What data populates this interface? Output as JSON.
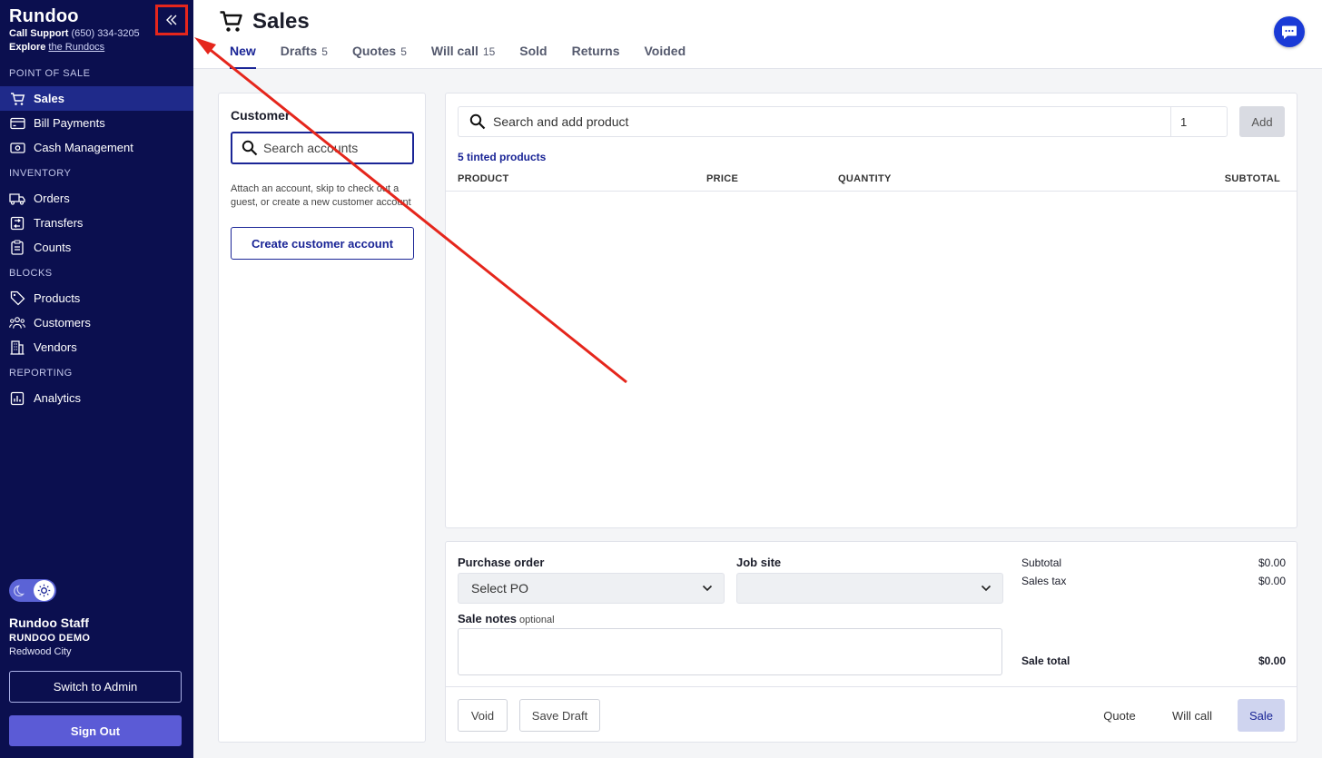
{
  "app": {
    "name": "Rundoo",
    "support_label": "Call Support",
    "support_phone": "(650) 334-3205",
    "explore_label": "Explore",
    "explore_link": "the Rundocs"
  },
  "sidebar": {
    "sections": [
      {
        "heading": "POINT OF SALE",
        "items": [
          {
            "label": "Sales",
            "icon": "cart-icon",
            "active": true
          },
          {
            "label": "Bill Payments",
            "icon": "credit-card-icon"
          },
          {
            "label": "Cash Management",
            "icon": "cash-icon"
          }
        ]
      },
      {
        "heading": "INVENTORY",
        "items": [
          {
            "label": "Orders",
            "icon": "truck-icon"
          },
          {
            "label": "Transfers",
            "icon": "transfer-icon"
          },
          {
            "label": "Counts",
            "icon": "clipboard-icon"
          }
        ]
      },
      {
        "heading": "BLOCKS",
        "items": [
          {
            "label": "Products",
            "icon": "tag-icon"
          },
          {
            "label": "Customers",
            "icon": "users-icon"
          },
          {
            "label": "Vendors",
            "icon": "building-icon"
          }
        ]
      },
      {
        "heading": "REPORTING",
        "items": [
          {
            "label": "Analytics",
            "icon": "chart-icon"
          }
        ]
      }
    ],
    "user": {
      "name": "Rundoo Staff",
      "org": "RUNDOO DEMO",
      "location": "Redwood City"
    },
    "switch_admin_label": "Switch to Admin",
    "sign_out_label": "Sign Out"
  },
  "header": {
    "title": "Sales",
    "tabs": [
      {
        "label": "New",
        "count": "",
        "active": true
      },
      {
        "label": "Drafts",
        "count": "5"
      },
      {
        "label": "Quotes",
        "count": "5"
      },
      {
        "label": "Will call",
        "count": "15"
      },
      {
        "label": "Sold",
        "count": ""
      },
      {
        "label": "Returns",
        "count": ""
      },
      {
        "label": "Voided",
        "count": ""
      }
    ]
  },
  "customer": {
    "title": "Customer",
    "search_placeholder": "Search accounts",
    "help_text": "Attach an account, skip to check out a guest, or create a new customer account",
    "create_label": "Create customer account"
  },
  "products": {
    "search_placeholder": "Search and add product",
    "quantity_value": "1",
    "add_label": "Add",
    "tinted_label": "5 tinted products",
    "columns": [
      "PRODUCT",
      "PRICE",
      "QUANTITY",
      "SUBTOTAL"
    ]
  },
  "order": {
    "po_label": "Purchase order",
    "po_value": "Select PO",
    "job_site_label": "Job site",
    "job_site_value": "",
    "notes_label": "Sale notes",
    "notes_optional": "optional",
    "subtotal_label": "Subtotal",
    "subtotal_value": "$0.00",
    "tax_label": "Sales tax",
    "tax_value": "$0.00",
    "total_label": "Sale total",
    "total_value": "$0.00"
  },
  "actions": {
    "void": "Void",
    "save_draft": "Save Draft",
    "quote": "Quote",
    "will_call": "Will call",
    "sale": "Sale"
  },
  "colors": {
    "sidebar_bg": "#0b0f4f",
    "accent": "#1a2596",
    "annotation": "#e5261c"
  }
}
